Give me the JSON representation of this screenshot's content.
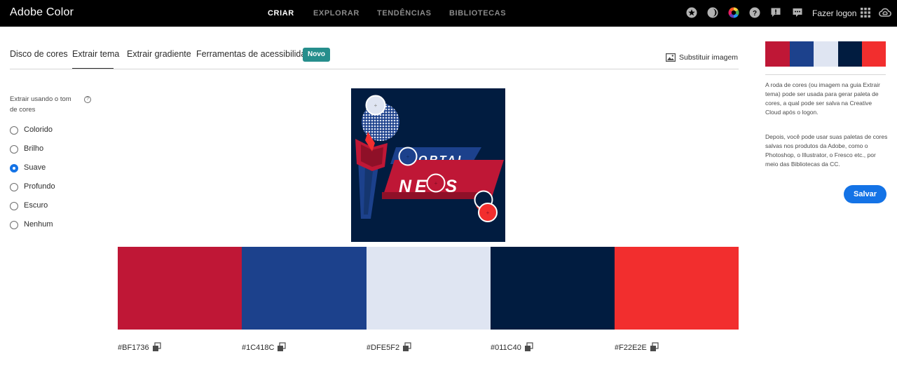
{
  "app": {
    "title": "Adobe Color"
  },
  "nav": {
    "items": [
      "CRIAR",
      "EXPLORAR",
      "TENDÊNCIAS",
      "BIBLIOTECAS"
    ],
    "active": "CRIAR",
    "login": "Fazer logon"
  },
  "top_icons": [
    "star-icon",
    "moon-icon",
    "color-wheel-icon",
    "help-icon",
    "feedback-icon",
    "chat-icon",
    "apps-grid-icon",
    "creative-cloud-icon"
  ],
  "tabs": {
    "items": [
      "Disco de cores",
      "Extrair tema",
      "Extrair gradiente",
      "Ferramentas de acessibilidade"
    ],
    "active": "Extrair tema",
    "badge": "Novo",
    "replace_image": "Substituir imagem"
  },
  "mood": {
    "label": "Extrair usando o tom de cores",
    "options": [
      "Colorido",
      "Brilho",
      "Suave",
      "Profundo",
      "Escuro",
      "Nenhum"
    ],
    "selected": "Suave"
  },
  "image": {
    "text_line1": "ORTAL",
    "text_line2": "NEVS"
  },
  "palette": [
    {
      "hex": "#BF1736",
      "color": "#BF1736"
    },
    {
      "hex": "#1C418C",
      "color": "#1C418C"
    },
    {
      "hex": "#DFE5F2",
      "color": "#DFE5F2"
    },
    {
      "hex": "#011C40",
      "color": "#011C40"
    },
    {
      "hex": "#F22E2E",
      "color": "#F22E2E"
    }
  ],
  "sidebar": {
    "info1": "A roda de cores (ou imagem na guia Extrair tema) pode ser usada para gerar paleta de cores, a qual pode ser salva na Creative Cloud após o logon.",
    "info2": "Depois, você pode usar suas paletas de cores salvas nos produtos da Adobe, como o Photoshop, o Illustrator, o Fresco etc., por meio das Bibliotecas da CC.",
    "save": "Salvar"
  },
  "colors": {
    "accent": "#1473E6",
    "badge": "#268E8C",
    "topbar": "#000000"
  }
}
